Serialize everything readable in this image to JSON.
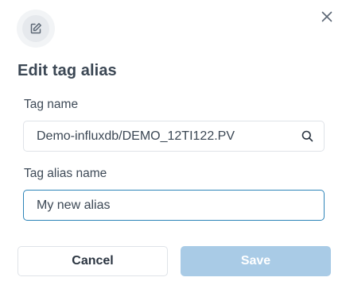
{
  "dialog": {
    "title": "Edit tag alias",
    "header_icon": "edit-icon",
    "close_icon": "close-icon"
  },
  "tag_name_field": {
    "label": "Tag name",
    "value": "Demo-influxdb/DEMO_12TI122.PV",
    "icon": "search-icon"
  },
  "alias_field": {
    "label": "Tag alias name",
    "value": "My new alias"
  },
  "buttons": {
    "cancel_label": "Cancel",
    "save_label": "Save"
  },
  "colors": {
    "accent": "#2d84b8",
    "save_disabled": "#a9cbe6",
    "text": "#3b4754"
  }
}
